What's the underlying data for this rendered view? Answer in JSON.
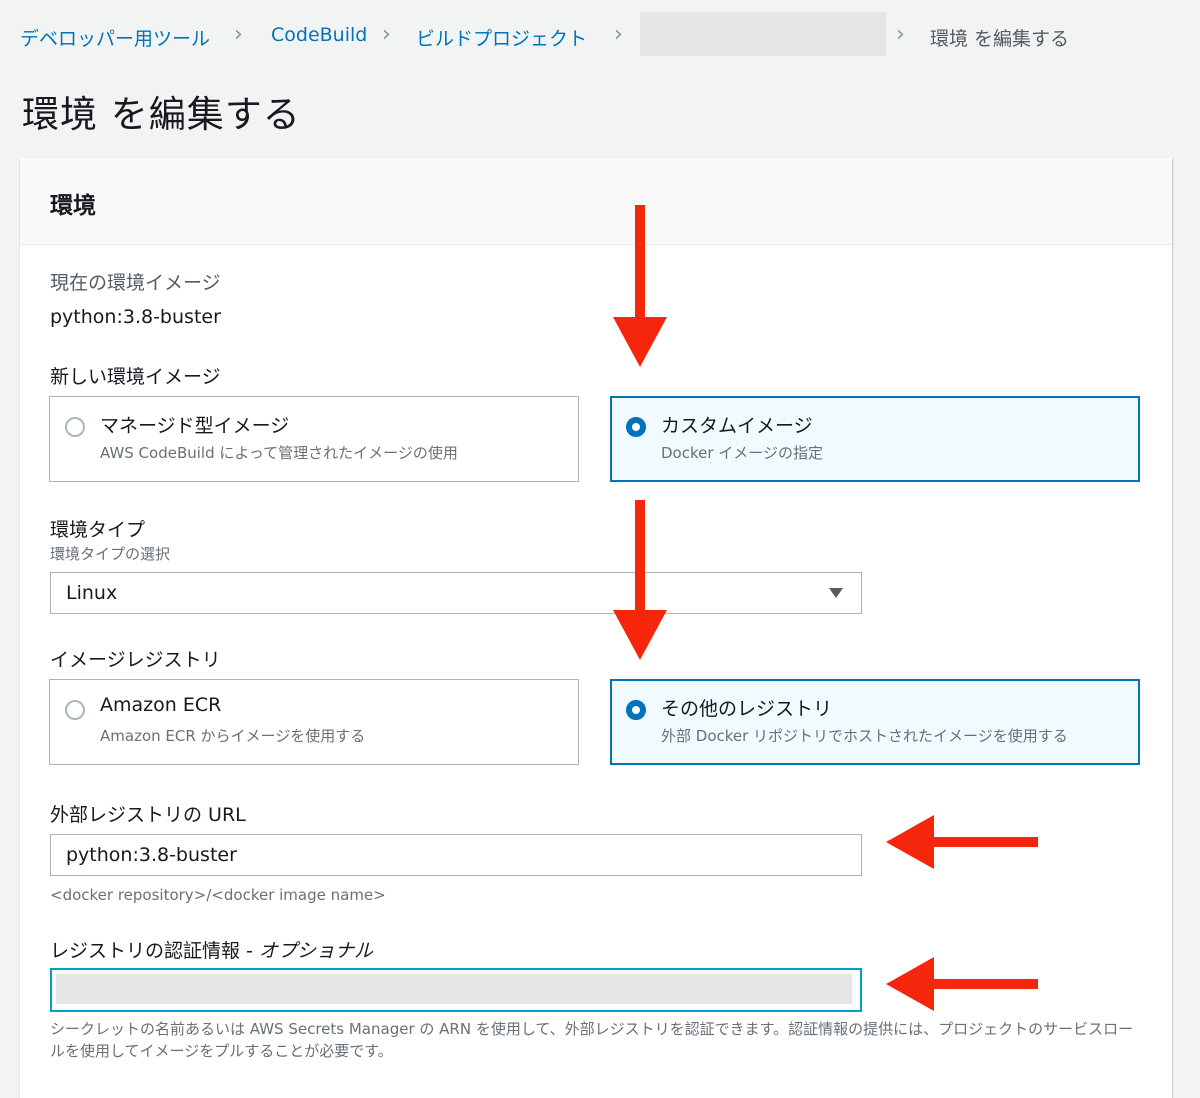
{
  "breadcrumb": {
    "items": [
      "デベロッパー用ツール",
      "CodeBuild",
      "ビルドプロジェクト"
    ],
    "current": "環境 を編集する"
  },
  "page": {
    "title": "環境 を編集する"
  },
  "panel": {
    "title": "環境",
    "current_image": {
      "label": "現在の環境イメージ",
      "value": "python:3.8-buster"
    },
    "new_image": {
      "label": "新しい環境イメージ",
      "options": [
        {
          "title": "マネージド型イメージ",
          "description": "AWS CodeBuild によって管理されたイメージの使用",
          "selected": false
        },
        {
          "title": "カスタムイメージ",
          "description": "Docker イメージの指定",
          "selected": true
        }
      ]
    },
    "environment_type": {
      "label": "環境タイプ",
      "description": "環境タイプの選択",
      "value": "Linux"
    },
    "image_registry": {
      "label": "イメージレジストリ",
      "options": [
        {
          "title": "Amazon ECR",
          "description": "Amazon ECR からイメージを使用する",
          "selected": false
        },
        {
          "title": "その他のレジストリ",
          "description": "外部 Docker リポジトリでホストされたイメージを使用する",
          "selected": true
        }
      ]
    },
    "external_registry_url": {
      "label": "外部レジストリの URL",
      "value": "python:3.8-buster",
      "hint": "<docker repository>/<docker image name>"
    },
    "registry_credential": {
      "label": "レジストリの認証情報 -",
      "label_optional": "オプショナル",
      "hint": "シークレットの名前あるいは AWS Secrets Manager の ARN を使用して、外部レジストリを認証できます。認証情報の提供には、プロジェクトのサービスロールを使用してイメージをプルすることが必要です。"
    }
  },
  "annotation_color": "#f5260c",
  "accent_color": "#0073bb"
}
